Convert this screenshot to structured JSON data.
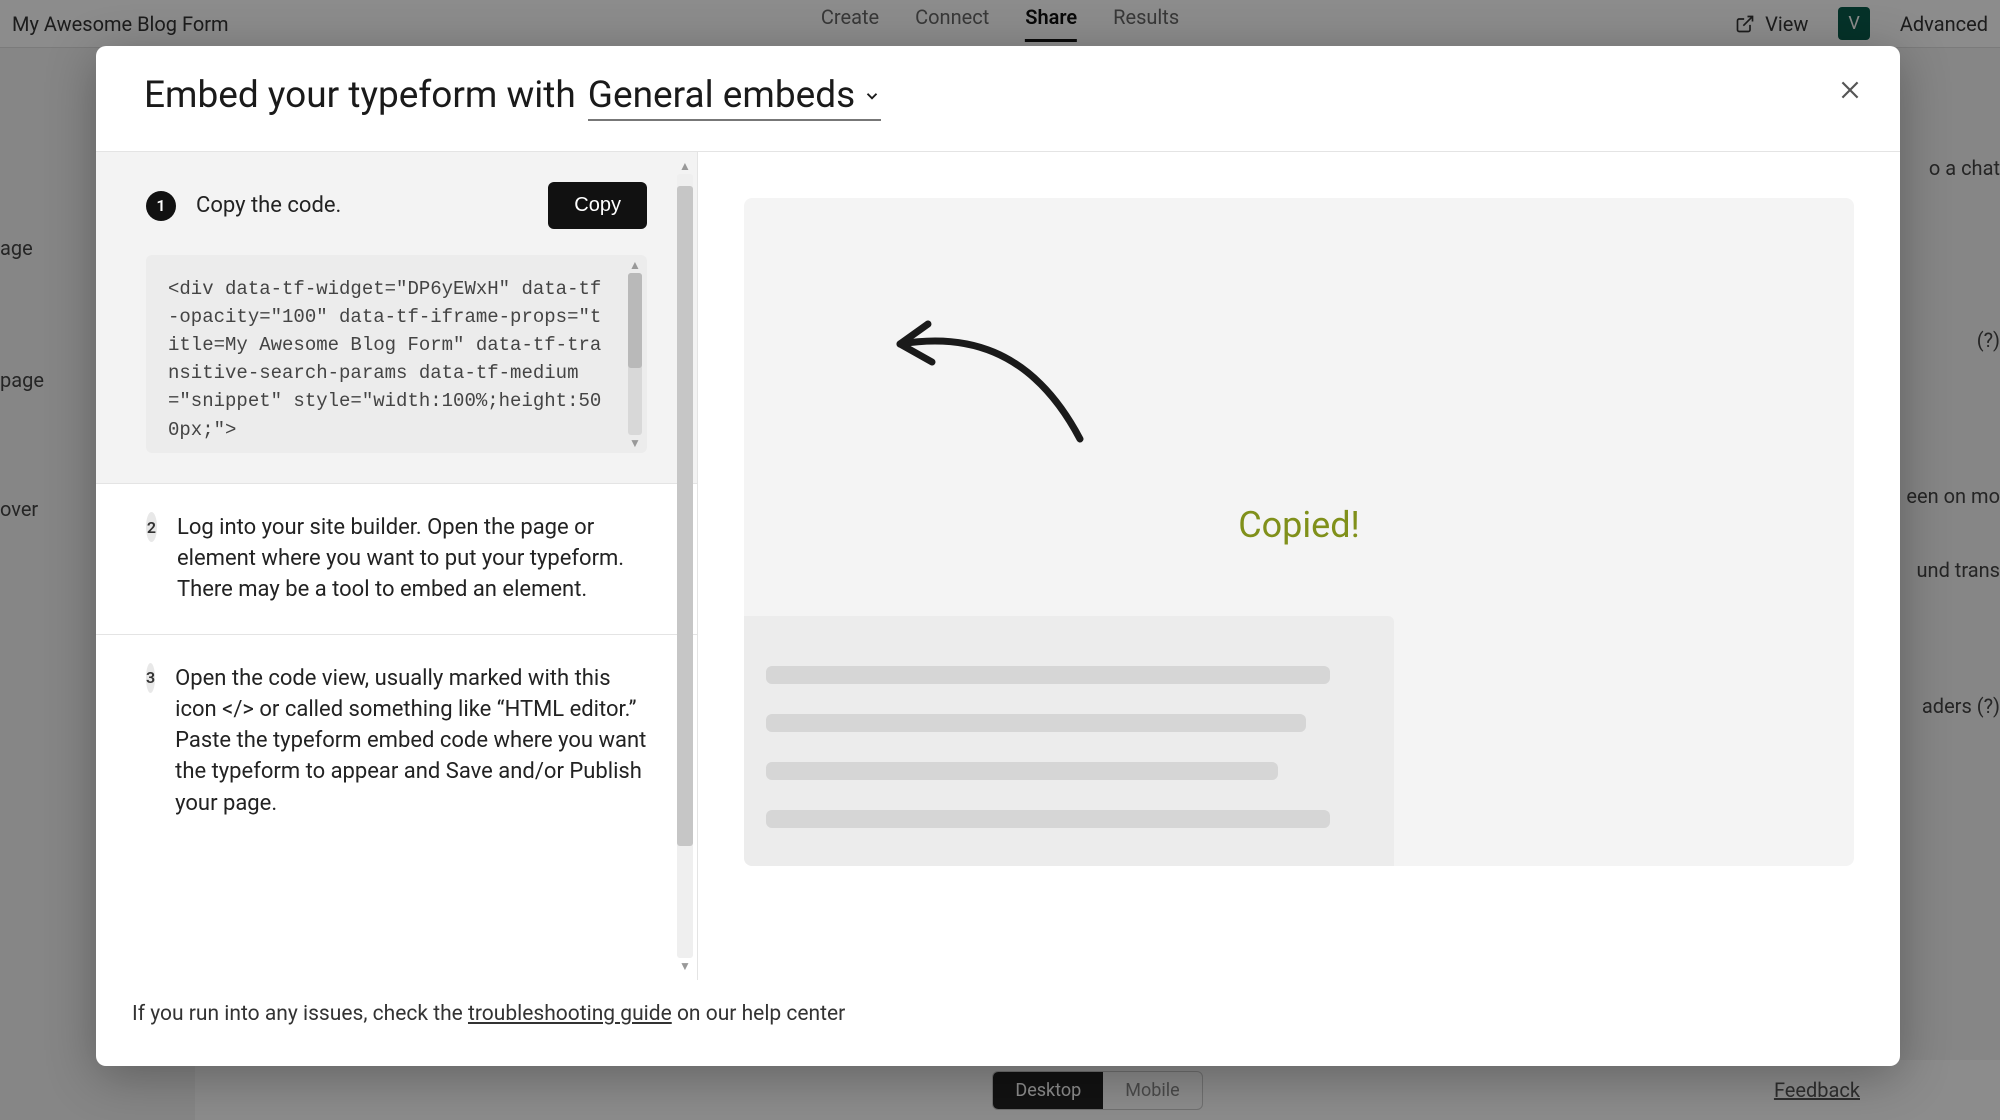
{
  "bgHeader": {
    "title": "My Awesome Blog Form",
    "tabs": {
      "create": "Create",
      "connect": "Connect",
      "share": "Share",
      "results": "Results"
    },
    "view": "View",
    "advanced": "Advanced"
  },
  "bgRight": {
    "r1": "o a chat",
    "r2": "(?)",
    "r3": "een on mo",
    "r4": "und trans",
    "r5": "aders (?)"
  },
  "bgLeft": {
    "l1": "age",
    "l2": "page",
    "l3": "over"
  },
  "bgBottom": {
    "desktop": "Desktop",
    "mobile": "Mobile",
    "feedback": "Feedback"
  },
  "modal": {
    "headerPrefix": "Embed your typeform with",
    "dropdown": "General embeds",
    "step1": {
      "num": "1",
      "title": "Copy the code.",
      "copy": "Copy",
      "code": "<div data-tf-widget=\"DP6yEWxH\" data-tf-opacity=\"100\" data-tf-iframe-props=\"title=My Awesome Blog Form\" data-tf-transitive-search-params data-tf-medium=\"snippet\" style=\"width:100%;height:500px;\">"
    },
    "step2": {
      "num": "2",
      "text": "Log into your site builder. Open the page or element where you want to put your typeform. There may be a tool to embed an element."
    },
    "step3": {
      "num": "3",
      "text": "Open the code view, usually marked with this icon </> or called something like “HTML editor.” Paste the typeform embed code where you want the typeform to appear and Save and/or Publish your page."
    },
    "preview": {
      "copied": "Copied!"
    },
    "footer": {
      "prefix": "If you run into any issues, check the ",
      "link": "troubleshooting guide",
      "suffix": " on our help center"
    }
  }
}
